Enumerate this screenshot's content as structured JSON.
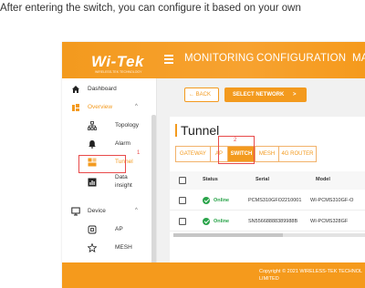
{
  "caption": "After entering the switch, you can configure it based on your own",
  "header": {
    "logo": "Wi-Tek",
    "logo_sub": "WIRELESS-TEK TECHNOLOGY",
    "nav": [
      "MONITORING",
      "CONFIGURATION",
      "MA"
    ]
  },
  "sidebar": {
    "items": [
      {
        "label": "Dashboard",
        "icon": "home-icon"
      },
      {
        "label": "Overview",
        "icon": "overview-icon",
        "expanded": true
      },
      {
        "label": "Topology",
        "icon": "topology-icon"
      },
      {
        "label": "Alarm",
        "icon": "bell-icon"
      },
      {
        "label": "Tunnel",
        "icon": "tunnel-icon",
        "selected": true
      },
      {
        "label": "Data\ninsight",
        "label_line1": "Data",
        "label_line2": "insight",
        "icon": "chart-icon"
      },
      {
        "label": "Device",
        "icon": "monitor-icon",
        "expanded": true
      },
      {
        "label": "AP",
        "icon": "ap-icon"
      },
      {
        "label": "MESH",
        "icon": "mesh-icon"
      }
    ]
  },
  "toolbar": {
    "back_label": "BACK",
    "select_network_label": "SELECT NETWORK",
    "select_network_arrow": ">"
  },
  "card": {
    "title": "Tunnel",
    "tabs": [
      "GATEWAY",
      "AP",
      "SWITCH",
      "MESH",
      "4G ROUTER"
    ],
    "active_tab": "SWITCH"
  },
  "table": {
    "headers": [
      "Status",
      "Serial",
      "Model"
    ],
    "rows": [
      {
        "status": "Online",
        "serial": "PCMS310GFO2210001",
        "model": "WI-PCMS310GF-O"
      },
      {
        "status": "Online",
        "serial": "SN55668888389988B",
        "model": "WI-PCMS328GF"
      }
    ]
  },
  "annotations": {
    "label1": "1",
    "label2": "2"
  },
  "footer": {
    "line1": "Copyright © 2021 WIRELESS-TEK TECHNOL",
    "line2": "LIMITED"
  },
  "colors": {
    "accent": "#f39a1e",
    "online": "#2aa44a",
    "annotation": "#e84a4a"
  }
}
